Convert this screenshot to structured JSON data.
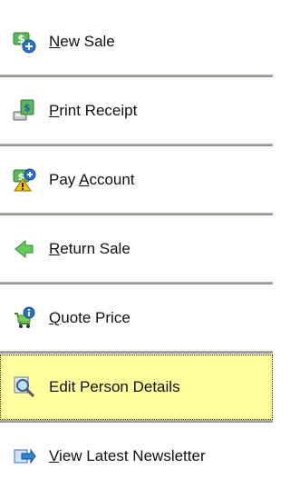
{
  "menu": {
    "items": [
      {
        "id": "new-sale",
        "access_key": "N",
        "rest": "ew Sale",
        "icon": "money-add-icon"
      },
      {
        "id": "print-receipt",
        "access_key": "P",
        "rest": "rint Receipt",
        "icon": "receipt-printer-icon"
      },
      {
        "id": "pay-account",
        "prefix": "Pay ",
        "access_key": "A",
        "rest": "ccount",
        "icon": "money-warning-icon"
      },
      {
        "id": "return-sale",
        "access_key": "R",
        "rest": "eturn Sale",
        "icon": "green-arrow-left-icon"
      },
      {
        "id": "quote-price",
        "access_key": "Q",
        "rest": "uote Price",
        "icon": "cart-info-icon"
      },
      {
        "id": "edit-person",
        "label": "Edit Person Details",
        "icon": "magnifier-icon",
        "selected": true
      },
      {
        "id": "view-newsletter",
        "access_key": "V",
        "rest": "iew Latest Newsletter",
        "icon": "newsletter-arrow-icon"
      }
    ],
    "selected_color": "#ffff9e",
    "divider_color": "#9a9590"
  }
}
